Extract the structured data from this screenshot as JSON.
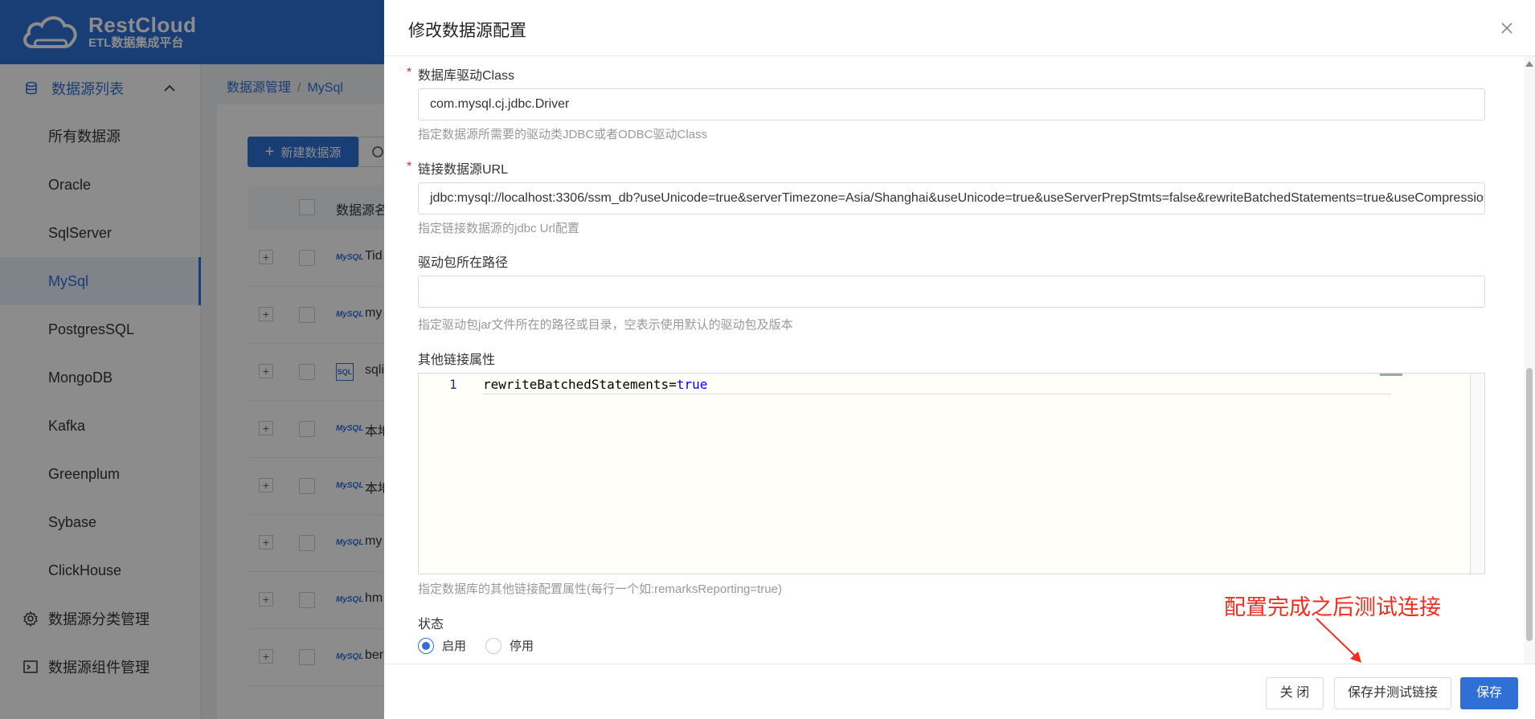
{
  "app": {
    "logo_name": "RestCloud",
    "logo_sub": "ETL数据集成平台"
  },
  "sidebar": {
    "group_label": "数据源列表",
    "items": [
      {
        "label": "所有数据源"
      },
      {
        "label": "Oracle"
      },
      {
        "label": "SqlServer"
      },
      {
        "label": "MySql",
        "active": true
      },
      {
        "label": "PostgresSQL"
      },
      {
        "label": "MongoDB"
      },
      {
        "label": "Kafka"
      },
      {
        "label": "Greenplum"
      },
      {
        "label": "Sybase"
      },
      {
        "label": "ClickHouse"
      }
    ],
    "menu_category": "数据源分类管理",
    "menu_component": "数据源组件管理"
  },
  "breadcrumb": {
    "root": "数据源管理",
    "sep": "/",
    "current": "MySql"
  },
  "toolbar": {
    "new_label": "新建数据源"
  },
  "table": {
    "header_name": "数据源名",
    "rows": [
      {
        "icon": "mysql-icon",
        "name": "Tid"
      },
      {
        "icon": "mysql-icon",
        "name": "my"
      },
      {
        "icon": "sql-server-icon",
        "name": "sqli"
      },
      {
        "icon": "mysql-icon",
        "name": "本地"
      },
      {
        "icon": "mysql-icon",
        "name": "本地"
      },
      {
        "icon": "mysql-icon",
        "name": "my"
      },
      {
        "icon": "mysql-icon",
        "name": "hm"
      },
      {
        "icon": "mysql-icon",
        "name": "ber"
      }
    ],
    "expand_symbol": "+",
    "mysql_badge": "MySQL",
    "sql_badge": "SQL"
  },
  "drawer": {
    "title": "修改数据源配置",
    "driver_class": {
      "label": "数据库驱动Class",
      "value": "com.mysql.cj.jdbc.Driver",
      "hint": "指定数据源所需要的驱动类JDBC或者ODBC驱动Class"
    },
    "url": {
      "label": "链接数据源URL",
      "value": "jdbc:mysql://localhost:3306/ssm_db?useUnicode=true&serverTimezone=Asia/Shanghai&useUnicode=true&useServerPrepStmts=false&rewriteBatchedStatements=true&useCompression=",
      "hint": "指定链接数据源的jdbc Url配置"
    },
    "driver_path": {
      "label": "驱动包所在路径",
      "value": "",
      "hint": "指定驱动包jar文件所在的路径或目录，空表示使用默认的驱动包及版本"
    },
    "props": {
      "label": "其他链接属性",
      "line_number": "1",
      "code_key": "rewriteBatchedStatements=",
      "code_value": "true",
      "hint": "指定数据库的其他链接配置属性(每行一个如:remarksReporting=true)"
    },
    "status": {
      "label": "状态",
      "options": [
        "启用",
        "停用"
      ],
      "selected": "启用"
    },
    "required_mark": "*",
    "annotation": "配置完成之后测试连接",
    "buttons": {
      "close": "关 闭",
      "save_test": "保存并测试链接",
      "save": "保存"
    }
  },
  "colors": {
    "primary": "#2f6fd6",
    "annotation": "#f52d1f",
    "required": "#f5222d"
  }
}
